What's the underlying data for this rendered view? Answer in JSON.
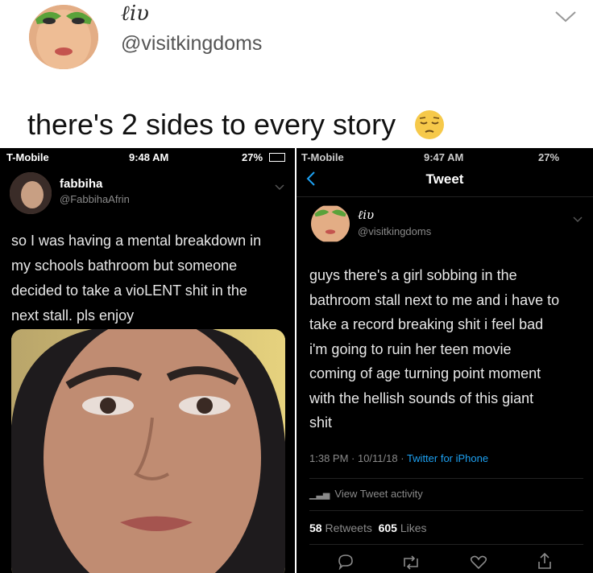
{
  "header": {
    "display_name": "ℓiυ",
    "handle": "@visitkingdoms",
    "tweet_text": "there's 2 sides to every story",
    "emoji": "pensive-face"
  },
  "left_screenshot": {
    "status_bar": {
      "carrier": "T-Mobile",
      "time": "9:48 AM",
      "battery": "27%"
    },
    "author_name": "fabbiha",
    "author_handle": "@FabbihaAfrin",
    "lines": [
      "so I was having a mental breakdown in",
      "my schools bathroom but someone",
      "decided to take a vioLENT shit in the",
      "next stall. pls enjoy"
    ]
  },
  "right_screenshot": {
    "status_bar": {
      "carrier": "T-Mobile",
      "time": "9:47 AM",
      "battery": "27%"
    },
    "nav_title": "Tweet",
    "author_name": "ℓiυ",
    "author_handle": "@visitkingdoms",
    "lines": [
      "guys there's a girl sobbing in the",
      "bathroom stall next to me and i have to",
      "take a record breaking shit i feel bad",
      "i'm going to ruin her teen movie",
      "coming of age turning point moment",
      "with the hellish sounds of this giant",
      "shit"
    ],
    "meta_time": "1:38 PM · 10/11/18 · ",
    "meta_source": "Twitter for iPhone",
    "activity_label": "View Tweet activity",
    "retweets_count": "58",
    "retweets_label": "Retweets",
    "likes_count": "605",
    "likes_label": "Likes"
  }
}
